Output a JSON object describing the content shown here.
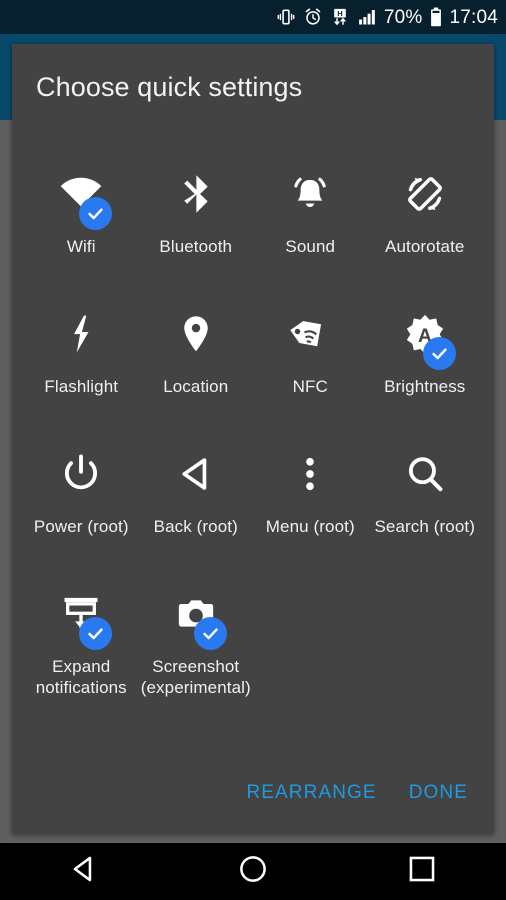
{
  "status_bar": {
    "icons": [
      {
        "name": "vibrate-icon",
        "label": "vibrate"
      },
      {
        "name": "alarm-icon",
        "label": "alarm"
      },
      {
        "name": "hspa-data-icon",
        "label": "H"
      },
      {
        "name": "signal-bars-icon",
        "label": "signal"
      }
    ],
    "battery_percent": "70%",
    "battery_icon": "battery-icon",
    "time": "17:04"
  },
  "dialog": {
    "title": "Choose quick settings",
    "actions": {
      "rearrange": "REARRANGE",
      "done": "DONE"
    }
  },
  "tiles": [
    {
      "label": "Wifi",
      "icon": "wifi-icon",
      "checked": true
    },
    {
      "label": "Bluetooth",
      "icon": "bluetooth-icon",
      "checked": false
    },
    {
      "label": "Sound",
      "icon": "bell-icon",
      "checked": false
    },
    {
      "label": "Autorotate",
      "icon": "screen-rotation-icon",
      "checked": false
    },
    {
      "label": "Flashlight",
      "icon": "flash-icon",
      "checked": false
    },
    {
      "label": "Location",
      "icon": "location-pin-icon",
      "checked": false
    },
    {
      "label": "NFC",
      "icon": "nfc-tag-icon",
      "checked": false
    },
    {
      "label": "Brightness",
      "icon": "auto-brightness-icon",
      "checked": true
    },
    {
      "label": "Power (root)",
      "icon": "power-icon",
      "checked": false
    },
    {
      "label": "Back (root)",
      "icon": "back-triangle-icon",
      "checked": false
    },
    {
      "label": "Menu (root)",
      "icon": "overflow-menu-icon",
      "checked": false
    },
    {
      "label": "Search (root)",
      "icon": "search-icon",
      "checked": false
    },
    {
      "label": "Expand\nnotifications",
      "icon": "expand-notifications-icon",
      "checked": true
    },
    {
      "label": "Screenshot\n(experimental)",
      "icon": "camera-icon",
      "checked": true
    }
  ],
  "nav_bar": {
    "back": "back-nav-icon",
    "home": "home-nav-icon",
    "recents": "recents-nav-icon"
  },
  "colors": {
    "accent_blue": "#2979f0",
    "link_blue": "#1e9ae0",
    "dialog_bg": "#434343",
    "backdrop_top": "#08496b",
    "backdrop_bottom": "#5f5f5f",
    "status_bar_bg": "#06202e"
  }
}
